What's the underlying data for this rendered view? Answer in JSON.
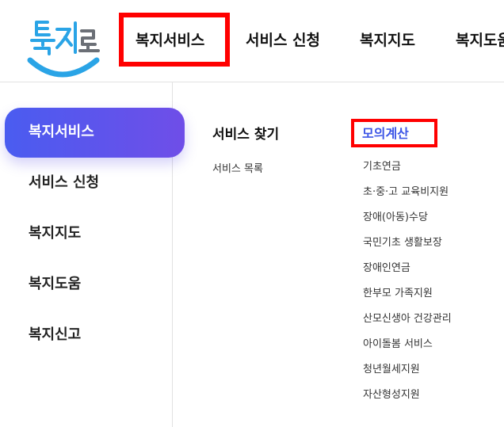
{
  "logo": {
    "text": "복지로",
    "icon": "bokjiro-logo-icon"
  },
  "gnb": {
    "items": [
      {
        "label": "복지서비스"
      },
      {
        "label": "서비스 신청"
      },
      {
        "label": "복지지도"
      },
      {
        "label": "복지도움"
      }
    ]
  },
  "side_menu": {
    "items": [
      {
        "label": "복지서비스"
      },
      {
        "label": "서비스 신청"
      },
      {
        "label": "복지지도"
      },
      {
        "label": "복지도움"
      },
      {
        "label": "복지신고"
      }
    ]
  },
  "content": {
    "column1": {
      "title": "서비스 찾기",
      "links": [
        "서비스 목록"
      ]
    },
    "column2": {
      "title": "모의계산",
      "links": [
        "기초연금",
        "초·중·고 교육비지원",
        "장애(아동)수당",
        "국민기초 생활보장",
        "장애인연금",
        "한부모 가족지원",
        "산모신생아 건강관리",
        "아이돌봄 서비스",
        "청년월세지원",
        "자산형성지원"
      ]
    }
  },
  "colors": {
    "accent": "#3d56e6",
    "gradient_start": "#4a5cf0",
    "gradient_end": "#6f4ee8",
    "highlight": "#ff0000",
    "logo_blue": "#2aa4e6",
    "logo_gray": "#6b6f76"
  }
}
